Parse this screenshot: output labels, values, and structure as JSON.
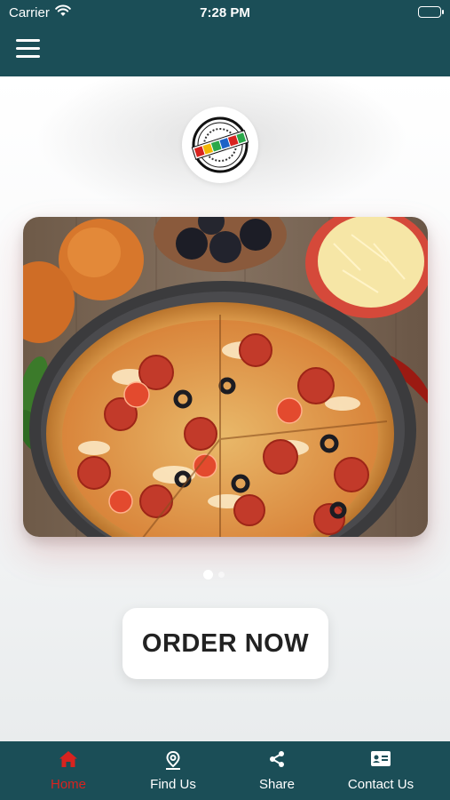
{
  "status_bar": {
    "carrier": "Carrier",
    "time": "7:28 PM"
  },
  "header": {
    "menu_icon": "hamburger-menu-icon"
  },
  "logo": {
    "text": "Pizza Baby"
  },
  "slider": {
    "image_desc": "pepperoni-pizza-photo",
    "page_index": 1
  },
  "order_button": {
    "label": "ORDER NOW"
  },
  "tabs": [
    {
      "label": "Home",
      "icon": "home-icon",
      "active": true
    },
    {
      "label": "Find Us",
      "icon": "location-pin-icon",
      "active": false
    },
    {
      "label": "Share",
      "icon": "share-icon",
      "active": false
    },
    {
      "label": "Contact Us",
      "icon": "contact-card-icon",
      "active": false
    }
  ],
  "colors": {
    "brand": "#1b4e57",
    "active_tab": "#d8231f",
    "button_text": "#222222"
  }
}
